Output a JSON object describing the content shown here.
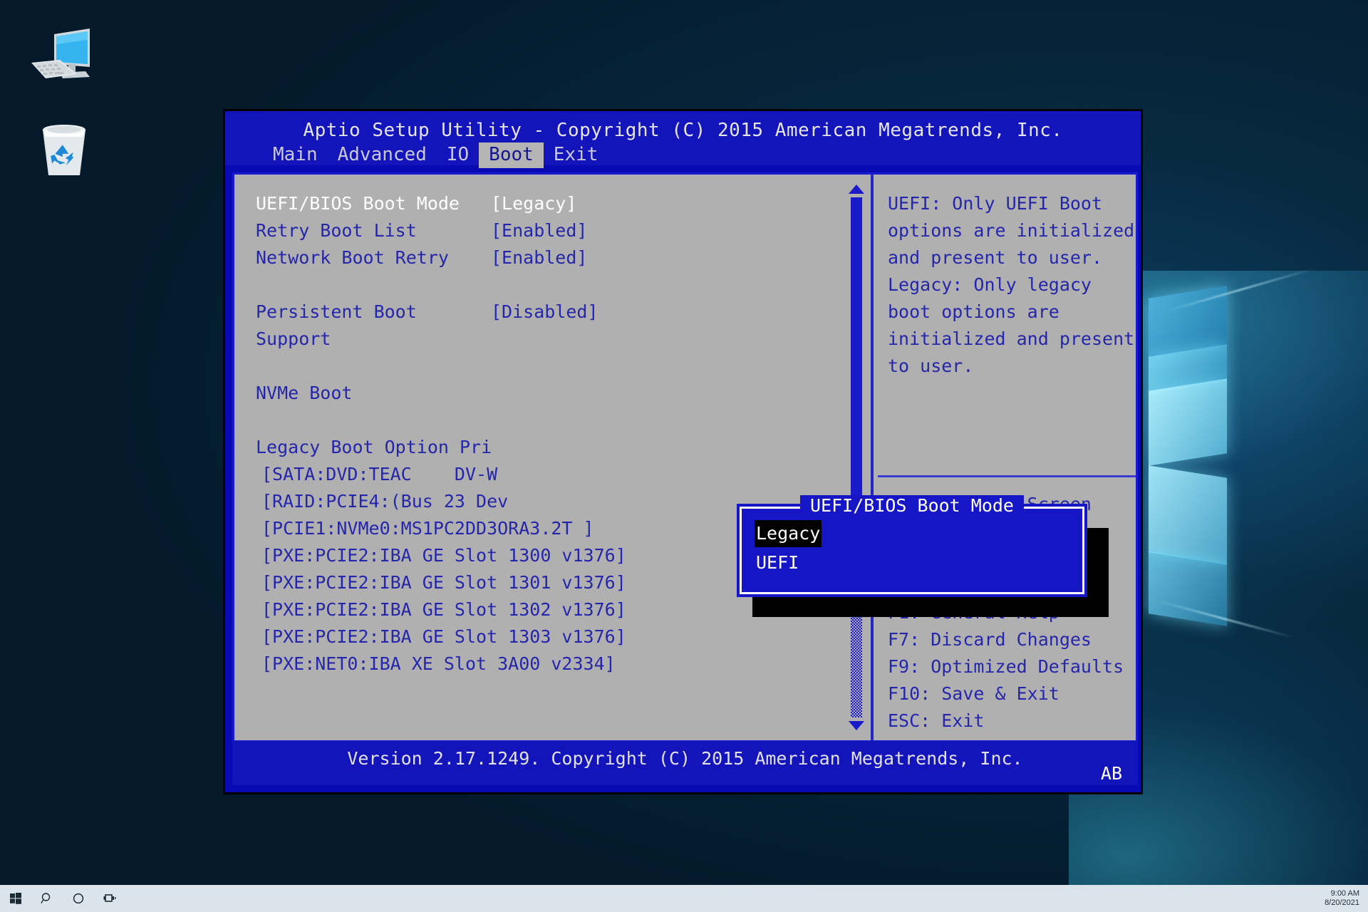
{
  "desktop": {
    "icons": [
      {
        "name": "this-pc-icon",
        "label": ""
      },
      {
        "name": "recycle-bin-icon",
        "label": ""
      }
    ],
    "wallpaper": "windows-10-hero",
    "background_color": "#06243c"
  },
  "taskbar": {
    "buttons": [
      {
        "name": "start-button",
        "icon": "windows-logo-icon"
      },
      {
        "name": "search-button",
        "icon": "search-icon"
      },
      {
        "name": "cortana-button",
        "icon": "circle-icon"
      },
      {
        "name": "task-view-button",
        "icon": "task-view-icon"
      }
    ],
    "clock": {
      "time": "9:00 AM",
      "date": "8/20/2021"
    },
    "background_color": "#dbe4ea"
  },
  "bios": {
    "title": "Aptio Setup Utility - Copyright (C) 2015 American Megatrends, Inc.",
    "accent_blue": "#1414bb",
    "panel_gray": "#b0b0b0",
    "text_blue": "#2626aa",
    "tabs": [
      {
        "label": "Main",
        "active": false
      },
      {
        "label": "Advanced",
        "active": false
      },
      {
        "label": "IO",
        "active": false
      },
      {
        "label": "Boot",
        "active": true
      },
      {
        "label": "Exit",
        "active": false
      }
    ],
    "settings": [
      {
        "label": "UEFI/BIOS Boot Mode",
        "value": "[Legacy]",
        "selected": true
      },
      {
        "label": "Retry Boot List",
        "value": "[Enabled]",
        "selected": false
      },
      {
        "label": "Network Boot Retry",
        "value": "[Enabled]",
        "selected": false
      }
    ],
    "persistent": {
      "label": "Persistent Boot",
      "value": "[Disabled]",
      "label2": "Support"
    },
    "nvme_boot_label": "NVMe Boot",
    "legacy_priority_header": "Legacy Boot Option Pri",
    "boot_options": [
      "[SATA:DVD:TEAC    DV-W",
      "[RAID:PCIE4:(Bus 23 Dev",
      "[PCIE1:NVMe0:MS1PC2DD3ORA3.2T ]",
      "[PXE:PCIE2:IBA GE Slot 1300 v1376]",
      "[PXE:PCIE2:IBA GE Slot 1301 v1376]",
      "[PXE:PCIE2:IBA GE Slot 1302 v1376]",
      "[PXE:PCIE2:IBA GE Slot 1303 v1376]",
      "[PXE:NET0:IBA XE Slot 3A00 v2334]"
    ],
    "help_text": "UEFI: Only UEFI Boot\noptions are initialized\nand present to user.\nLegacy: Only legacy\nboot options are\ninitialized and present\nto user.",
    "key_legend": "      Select Screen\n      Select Item\nEnter: Select\n+/-: Change Opt.\nF1: General Help\nF7: Discard Changes\nF9: Optimized Defaults\nF10: Save & Exit\nESC: Exit",
    "version_text": "Version 2.17.1249. Copyright (C) 2015 American Megatrends, Inc.",
    "version_corner": "AB",
    "scrollbar": {
      "up_arrow": "scroll-up-arrow",
      "down_arrow": "scroll-down-arrow"
    }
  },
  "dialog": {
    "title": "UEFI/BIOS Boot Mode",
    "options": [
      {
        "label": "Legacy",
        "selected": true
      },
      {
        "label": "UEFI",
        "selected": false
      }
    ],
    "background_color": "#1616c6",
    "highlight_color": "#000000"
  }
}
